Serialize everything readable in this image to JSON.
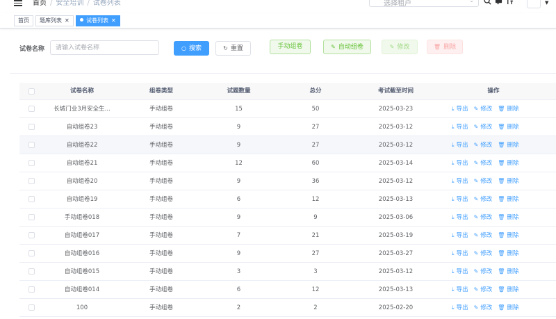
{
  "nav": {
    "breadcrumbs": [
      "首页",
      "安全培训",
      "试卷列表"
    ],
    "tenant_placeholder": "选择租户"
  },
  "tags": [
    {
      "label": "首页"
    },
    {
      "label": "题库列表"
    },
    {
      "label": "试卷列表"
    }
  ],
  "search": {
    "label": "试卷名称",
    "placeholder": "请输入试卷名称",
    "search_btn": "搜索",
    "reset_btn": "重置"
  },
  "toolbar": {
    "manual": "手动组卷",
    "auto": "自动组卷",
    "edit": "修改",
    "delete": "删除"
  },
  "table": {
    "columns": [
      "试卷名称",
      "组卷类型",
      "试题数量",
      "总分",
      "考试截至时间",
      "操作"
    ],
    "ops": {
      "export": "导出",
      "edit": "修改",
      "delete": "删除"
    },
    "rows": [
      {
        "name": "长城门业3月安全生...",
        "type": "手动组卷",
        "count": "15",
        "score": "50",
        "deadline": "2025-03-23"
      },
      {
        "name": "自动组卷23",
        "type": "手动组卷",
        "count": "9",
        "score": "27",
        "deadline": "2025-03-12"
      },
      {
        "name": "自动组卷22",
        "type": "手动组卷",
        "count": "9",
        "score": "27",
        "deadline": "2025-03-12"
      },
      {
        "name": "自动组卷21",
        "type": "手动组卷",
        "count": "12",
        "score": "60",
        "deadline": "2025-03-14"
      },
      {
        "name": "自动组卷20",
        "type": "手动组卷",
        "count": "9",
        "score": "36",
        "deadline": "2025-03-12"
      },
      {
        "name": "自动组卷19",
        "type": "手动组卷",
        "count": "6",
        "score": "12",
        "deadline": "2025-03-13"
      },
      {
        "name": "手动组卷018",
        "type": "手动组卷",
        "count": "9",
        "score": "9",
        "deadline": "2025-03-06"
      },
      {
        "name": "自动组卷017",
        "type": "手动组卷",
        "count": "7",
        "score": "21",
        "deadline": "2025-03-19"
      },
      {
        "name": "自动组卷016",
        "type": "手动组卷",
        "count": "9",
        "score": "27",
        "deadline": "2025-03-27"
      },
      {
        "name": "自动组卷015",
        "type": "手动组卷",
        "count": "3",
        "score": "3",
        "deadline": "2025-03-12"
      },
      {
        "name": "自动组卷014",
        "type": "手动组卷",
        "count": "6",
        "score": "12",
        "deadline": "2025-03-13"
      },
      {
        "name": "100",
        "type": "手动组卷",
        "count": "2",
        "score": "2",
        "deadline": "2025-02-20"
      }
    ]
  }
}
